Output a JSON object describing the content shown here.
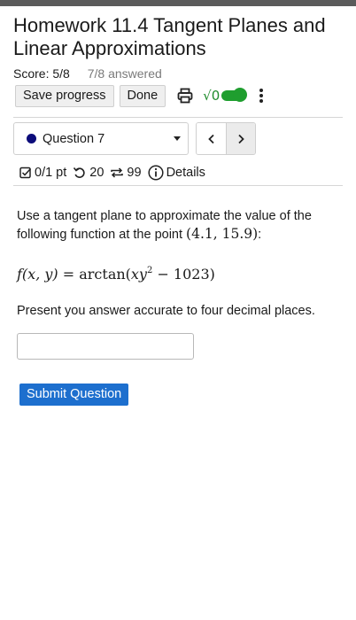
{
  "header": {
    "title": "Homework 11.4 Tangent Planes and Linear Approximations",
    "score": "Score: 5/8",
    "answered": "7/8 answered"
  },
  "toolbar": {
    "save_label": "Save progress",
    "done_label": "Done",
    "print_icon": "printer-icon",
    "math_toggle_glyph": "√0",
    "math_toggle_state": "on",
    "more_icon": "kebab-icon",
    "accent_color": "#1f9e2f"
  },
  "question_nav": {
    "selected": "Question 7",
    "status_color": "#0c0c7a",
    "prev_glyph": "‹",
    "next_glyph": "›"
  },
  "meta": {
    "points": "0/1 pt",
    "retries": "20",
    "versions": "99",
    "details_label": "Details"
  },
  "question": {
    "prompt": "Use a tangent plane to approximate the value of the following function at the point",
    "point": "(4.1, 15.9)",
    "prompt_end": ":",
    "formula_lhs": "f(x, y)",
    "formula_eq": "=",
    "formula_fn": "arctan",
    "formula_arg_var": "xy",
    "formula_arg_exp": "2",
    "formula_arg_rest": "− 1023)",
    "instruction": "Present you answer accurate to four decimal places.",
    "answer_value": "",
    "answer_placeholder": ""
  },
  "submit": {
    "label": "Submit Question",
    "color": "#1d6fce"
  }
}
